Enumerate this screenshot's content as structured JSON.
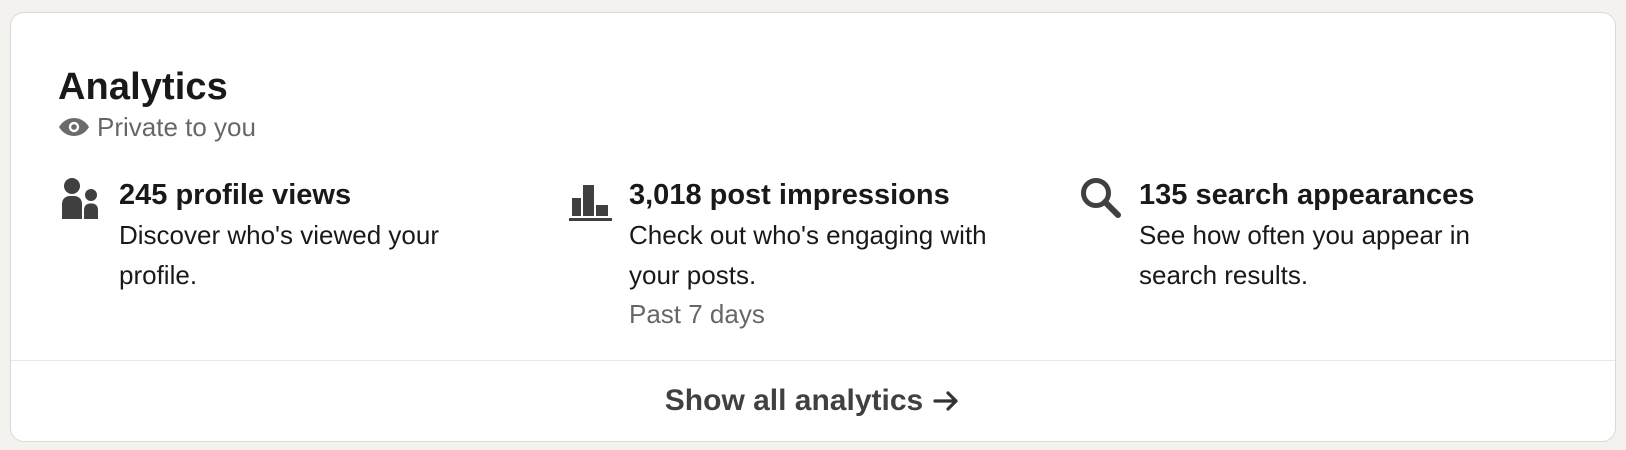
{
  "card": {
    "title": "Analytics",
    "privacy_label": "Private to you",
    "privacy_icon": "eye-icon"
  },
  "metrics": [
    {
      "icon": "people-icon",
      "headline": "245 profile views",
      "description": "Discover who's viewed your profile.",
      "subtext": ""
    },
    {
      "icon": "bar-chart-icon",
      "headline": "3,018 post impressions",
      "description": "Check out who's engaging with your posts.",
      "subtext": "Past 7 days"
    },
    {
      "icon": "search-icon",
      "headline": "135 search appearances",
      "description": "See how often you appear in search results.",
      "subtext": ""
    }
  ],
  "footer": {
    "show_all_label": "Show all analytics",
    "arrow_icon": "arrow-right-icon"
  },
  "colors": {
    "page_background": "#f4f2ee",
    "card_background": "#ffffff",
    "icon": "#404040",
    "primary_text": "#1a1a1a",
    "secondary_text": "#666666"
  }
}
